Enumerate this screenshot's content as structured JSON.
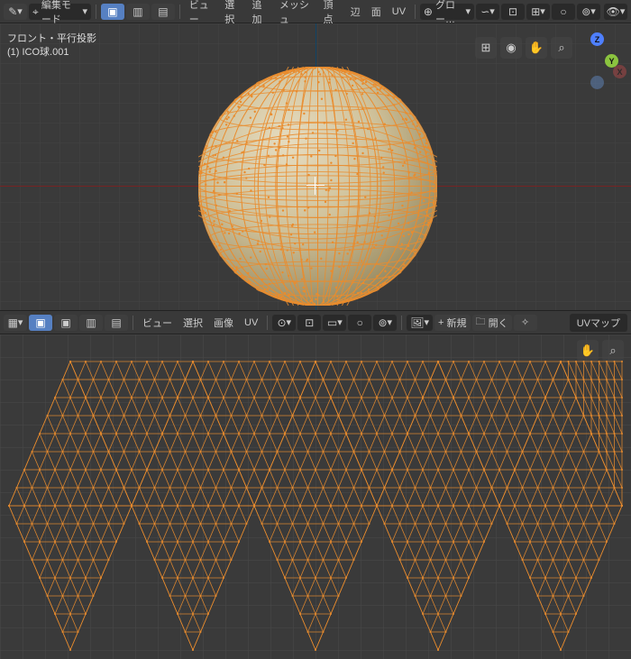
{
  "top_toolbar": {
    "mode": "編集モード",
    "menu": {
      "view": "ビュー",
      "select": "選択",
      "add": "追加",
      "mesh": "メッシュ",
      "vertex": "頂点",
      "edge": "辺",
      "face": "面",
      "uv": "UV"
    },
    "orient": "グロー…"
  },
  "viewport": {
    "projection": "フロント・平行投影",
    "object": "(1) ICO球.001"
  },
  "gizmo": {
    "z": "Z",
    "y": "Y",
    "x": "X"
  },
  "uv_toolbar": {
    "menu": {
      "view": "ビュー",
      "select": "選択",
      "image": "画像",
      "uv": "UV"
    },
    "new": "新規",
    "open": "開く"
  },
  "uv_dropdown": "UVマップ",
  "icons": {
    "brush": "✎",
    "cursor": "⌖",
    "mode": "▦",
    "vert": "▣",
    "edge": "▥",
    "face": "▤",
    "grid": "⊞",
    "cam": "◉",
    "hand": "✋",
    "zoom": "⌕",
    "pivot": "⊙",
    "snap": "⊡",
    "prop": "○",
    "link": "∽",
    "overlay": "◑",
    "arrow": "▾",
    "plus": "+",
    "folder": "🗀",
    "pin": "✧",
    "xray": "◎"
  }
}
